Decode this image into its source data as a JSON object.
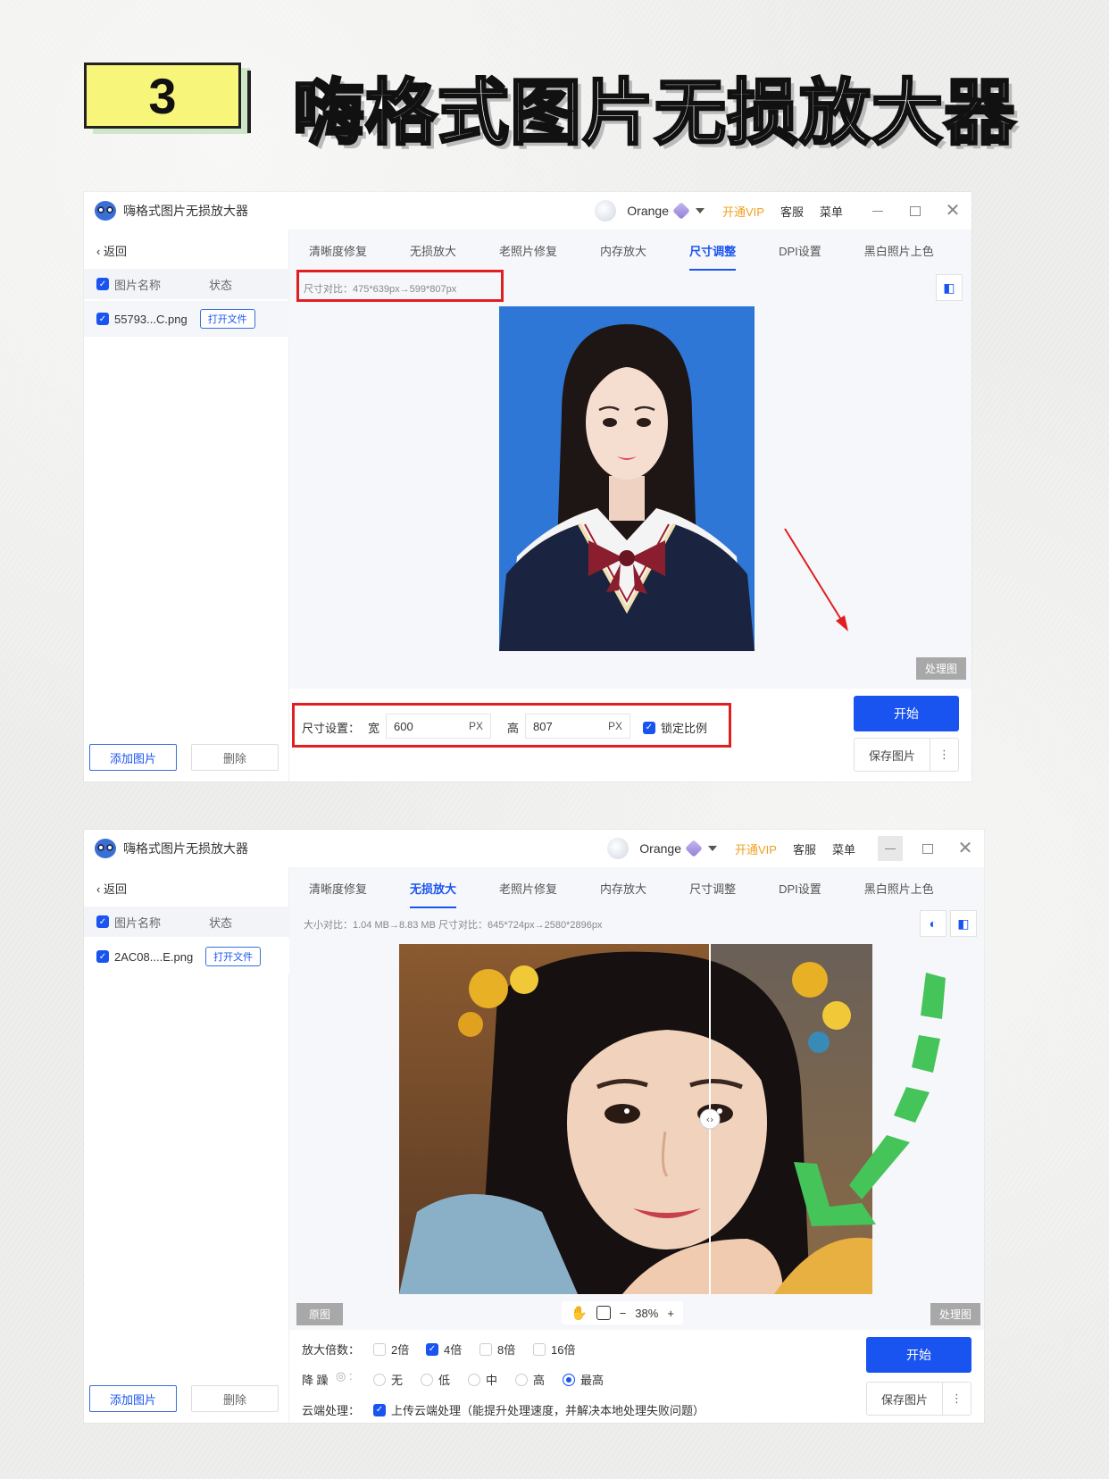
{
  "heading": {
    "number": "3",
    "title": "嗨格式图片无损放大器"
  },
  "app": {
    "title": "嗨格式图片无损放大器",
    "user": "Orange",
    "vip": "开通VIP",
    "service": "客服",
    "menu": "菜单",
    "back": "返回",
    "col_name": "图片名称",
    "col_status": "状态",
    "open_file": "打开文件",
    "add_image": "添加图片",
    "delete": "删除",
    "start": "开始",
    "save": "保存图片",
    "processed_tag": "处理图",
    "tabs": [
      "清晰度修复",
      "无损放大",
      "老照片修复",
      "内存放大",
      "尺寸调整",
      "DPI设置",
      "黑白照片上色"
    ]
  },
  "window1": {
    "file": "55793...C.png",
    "active_tab": "尺寸调整",
    "size_compare": "尺寸对比：475*639px→599*807px",
    "size_label": "尺寸设置：",
    "width_label": "宽",
    "width_value": "600",
    "height_label": "高",
    "height_value": "807",
    "unit": "PX",
    "lock_ratio": "锁定比例"
  },
  "window2": {
    "file": "2AC08....E.png",
    "active_tab": "无损放大",
    "info": "大小对比：1.04 MB→8.83 MB   尺寸对比：645*724px→2580*2896px",
    "original_tag": "原图",
    "zoom": "38%",
    "scale_label": "放大倍数：",
    "scale_options": [
      "2倍",
      "4倍",
      "8倍",
      "16倍"
    ],
    "scale_selected": "4倍",
    "denoise_label": "降 躁",
    "denoise_options": [
      "无",
      "低",
      "中",
      "高",
      "最高"
    ],
    "denoise_selected": "最高",
    "cloud_label": "云端处理：",
    "cloud_option": "上传云端处理（能提升处理速度，并解决本地处理失败问题）"
  },
  "colors": {
    "accent": "#1a54f0",
    "vip": "#f0a020",
    "highlight": "#e02020",
    "arrow_green": "#45c45a",
    "photo_bg": "#2e77d6"
  }
}
